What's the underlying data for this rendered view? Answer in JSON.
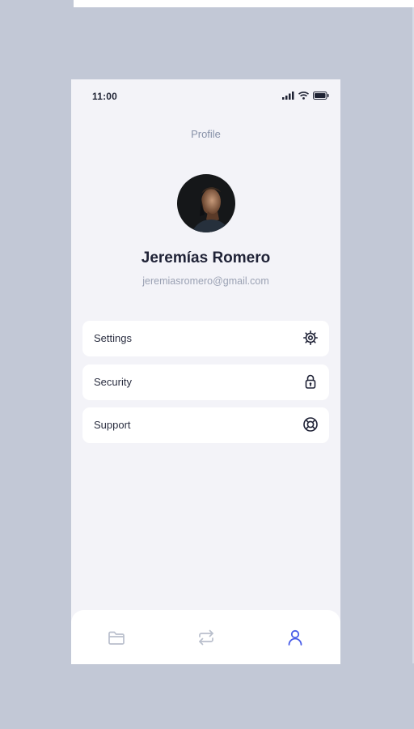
{
  "status_bar": {
    "time": "11:00"
  },
  "header": {
    "title": "Profile"
  },
  "profile": {
    "name": "Jeremías Romero",
    "email": "jeremiasromero@gmail.com"
  },
  "menu": {
    "items": [
      {
        "label": "Settings",
        "icon": "gear-icon"
      },
      {
        "label": "Security",
        "icon": "lock-icon"
      },
      {
        "label": "Support",
        "icon": "lifebuoy-icon"
      }
    ]
  },
  "bottom_nav": {
    "items": [
      {
        "icon": "folder-icon",
        "active": false
      },
      {
        "icon": "transfer-icon",
        "active": false
      },
      {
        "icon": "user-icon",
        "active": true
      }
    ],
    "active_color": "#4a5ee8",
    "inactive_color": "#b9bfcc"
  },
  "colors": {
    "background": "#c2c8d6",
    "screen": "#f3f3f8",
    "card": "#ffffff",
    "accent": "#4a5ee8"
  }
}
